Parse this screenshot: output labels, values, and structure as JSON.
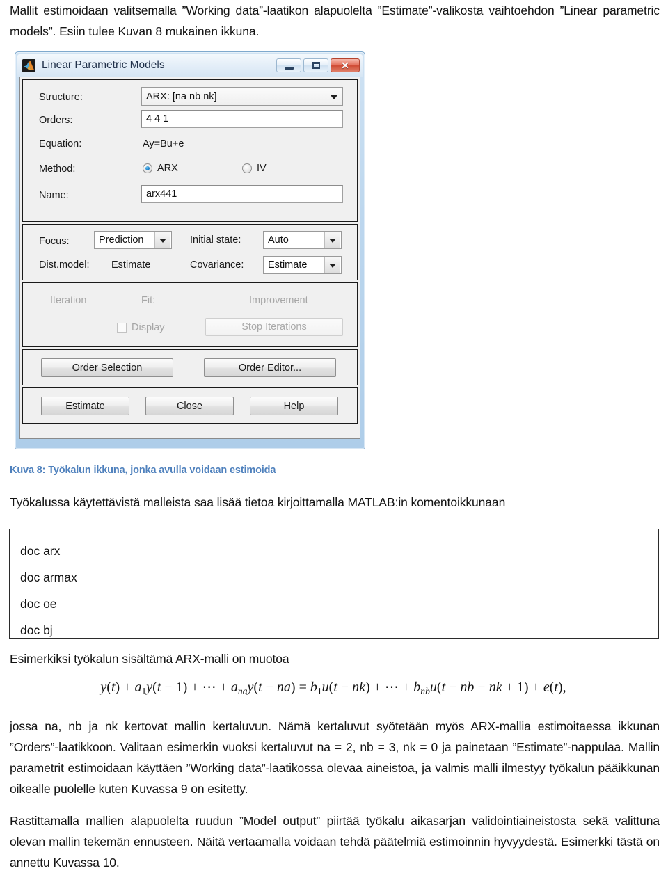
{
  "document": {
    "intro_paragraph": "Mallit estimoidaan valitsemalla ”Working data”-laatikon alapuolelta ”Estimate”-valikosta vaihtoehdon ”Linear parametric models”. Esiin tulee Kuvan 8 mukainen ikkuna.",
    "figure_caption": "Kuva 8: Työkalun ikkuna, jonka avulla voidaan estimoida",
    "lead_paragraph": "Työkalussa käytettävistä malleista saa lisää tietoa kirjoittamalla MATLAB:in komentoikkunaan",
    "code_lines": [
      "doc arx",
      "doc armax",
      "doc oe",
      "doc bj"
    ],
    "example_line": "Esimerkiksi työkalun sisältämä ARX-malli on muotoa",
    "equation_plain": "y(t) + a1 y(t − 1) + ⋯ + a_na y(t − na) = b1 u(t − nk) + ⋯ + b_nb u(t − nb − nk + 1) + e(t) ,",
    "paragraph_jossa": "jossa na, nb ja nk kertovat mallin kertaluvun. Nämä kertaluvut syötetään myös ARX-mallia estimoitaessa ikkunan ”Orders”-laatikkoon. Valitaan esimerkin vuoksi kertaluvut na = 2, nb = 3, nk = 0 ja painetaan ”Estimate”-nappulaa. Mallin parametrit estimoidaan käyttäen ”Working data”-laatikossa olevaa aineistoa, ja valmis malli ilmestyy työkalun pääikkunan oikealle puolelle kuten Kuvassa 9 on esitetty.",
    "paragraph_rastittamalla": "Rastittamalla mallien alapuolelta ruudun ”Model output” piirtää työkalu aikasarjan validointiaineistosta sekä valittuna olevan mallin tekemän ennusteen. Näitä vertaamalla voidaan tehdä päätelmiä estimoinnin hyvyydestä. Esimerkki tästä on annettu Kuvassa 10."
  },
  "dialog": {
    "title": "Linear Parametric Models",
    "app_icon": "matlab-logo-icon",
    "window_buttons": {
      "minimize": "minimize-icon",
      "maximize": "maximize-icon",
      "close": "✕"
    },
    "model_panel": {
      "structure_label": "Structure:",
      "structure_value": "ARX: [na nb nk]",
      "orders_label": "Orders:",
      "orders_value": "4 4 1",
      "equation_label": "Equation:",
      "equation_value": "Ay=Bu+e",
      "method_label": "Method:",
      "method_options": [
        "ARX",
        "IV"
      ],
      "method_selected": "ARX",
      "name_label": "Name:",
      "name_value": "arx441"
    },
    "options_panel": {
      "focus_label": "Focus:",
      "focus_value": "Prediction",
      "initial_state_label": "Initial state:",
      "initial_state_value": "Auto",
      "dist_model_label": "Dist.model:",
      "dist_model_value": "Estimate",
      "covariance_label": "Covariance:",
      "covariance_value": "Estimate"
    },
    "iteration_panel": {
      "iteration_label": "Iteration",
      "fit_label": "Fit:",
      "improvement_label": "Improvement",
      "display_checkbox_label": "Display",
      "display_checked": false,
      "stop_iterations_label": "Stop Iterations"
    },
    "order_panel": {
      "order_selection_label": "Order Selection",
      "order_editor_label": "Order Editor..."
    },
    "action_panel": {
      "estimate_label": "Estimate",
      "close_label": "Close",
      "help_label": "Help"
    }
  },
  "colors": {
    "caption_blue": "#4f81bd",
    "titlebar_blue": "#bdd7ee",
    "dialog_face": "#f0f0f0",
    "radio_accent": "#1177c4",
    "close_red": "#cf4a33"
  }
}
